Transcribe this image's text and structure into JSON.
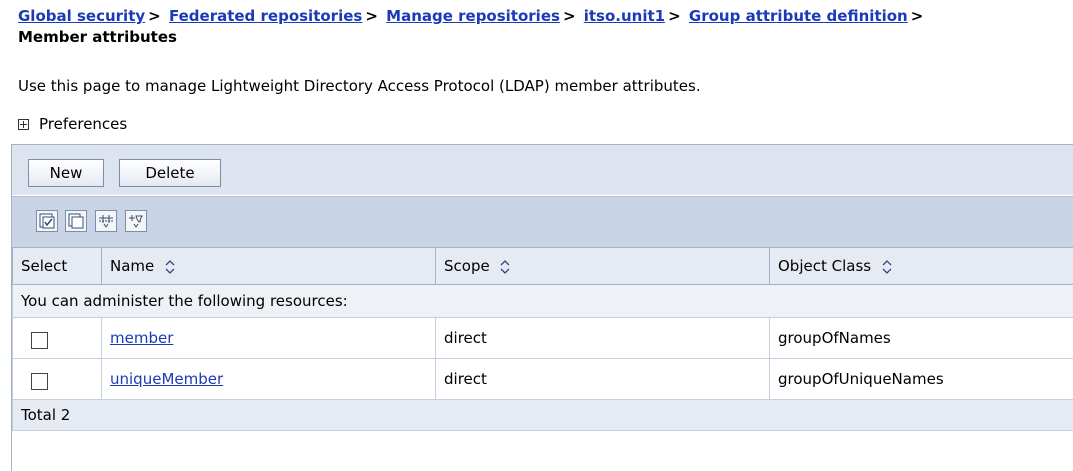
{
  "breadcrumb": {
    "items": [
      {
        "label": "Global security"
      },
      {
        "label": "Federated repositories"
      },
      {
        "label": "Manage repositories"
      },
      {
        "label": "itso.unit1"
      },
      {
        "label": "Group attribute definition"
      }
    ],
    "separator": ">"
  },
  "page": {
    "title": "Member attributes",
    "description": "Use this page to manage Lightweight Directory Access Protocol (LDAP) member attributes.",
    "preferences_label": "Preferences"
  },
  "toolbar": {
    "new_label": "New",
    "delete_label": "Delete",
    "icons": [
      "select-all-icon",
      "deselect-all-icon",
      "show-filter-icon",
      "clear-filter-icon"
    ]
  },
  "table": {
    "columns": {
      "select": "Select",
      "name": "Name",
      "scope": "Scope",
      "object_class": "Object Class"
    },
    "group_label": "You can administer the following resources:",
    "rows": [
      {
        "name": "member",
        "scope": "direct",
        "object_class": "groupOfNames"
      },
      {
        "name": "uniqueMember",
        "scope": "direct",
        "object_class": "groupOfUniqueNames"
      }
    ],
    "total_label": "Total 2"
  },
  "colors": {
    "link": "#1a3ab8",
    "header_bg": "#e6ebf3",
    "toolbar_bg": "#dde4ef",
    "icon_bar_bg": "#c9d4e6"
  }
}
